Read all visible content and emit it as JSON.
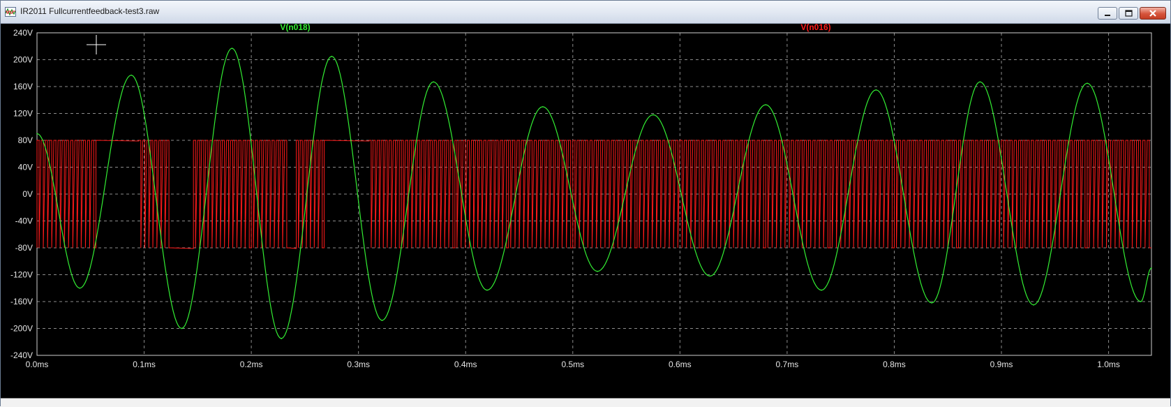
{
  "window": {
    "title": "IR2011 Fullcurrentfeedback-test3.raw",
    "app_icon": "waveform-icon",
    "controls": [
      "minimize-icon",
      "maximize-icon",
      "close-icon"
    ]
  },
  "colors": {
    "background": "#000000",
    "grid": "#8c8c8c",
    "axis_text": "#e6e6e6",
    "series_green": "#33ee33",
    "series_red": "#ff1a1a"
  },
  "chart_data": {
    "type": "line",
    "title": "",
    "xlabel": "",
    "ylabel": "",
    "xlim": [
      0,
      1.04
    ],
    "ylim": [
      -240,
      240
    ],
    "grid": true,
    "x_ticks": [
      0,
      0.1,
      0.2,
      0.3,
      0.4,
      0.5,
      0.6,
      0.7,
      0.8,
      0.9,
      1.0
    ],
    "x_tick_labels": [
      "0.0ms",
      "0.1ms",
      "0.2ms",
      "0.3ms",
      "0.4ms",
      "0.5ms",
      "0.6ms",
      "0.7ms",
      "0.8ms",
      "0.9ms",
      "1.0ms"
    ],
    "y_ticks": [
      240,
      200,
      160,
      120,
      80,
      40,
      0,
      -40,
      -80,
      -120,
      -160,
      -200,
      -240
    ],
    "y_tick_labels": [
      "240V",
      "200V",
      "160V",
      "120V",
      "80V",
      "40V",
      "0V",
      "-40V",
      "-80V",
      "-120V",
      "-160V",
      "-200V",
      "-240V"
    ],
    "series": [
      {
        "name": "V(n018)",
        "color": "#33ee33",
        "kind": "sine",
        "x": [
          0.0,
          0.04,
          0.088,
          0.135,
          0.182,
          0.228,
          0.275,
          0.322,
          0.37,
          0.42,
          0.472,
          0.523,
          0.575,
          0.628,
          0.68,
          0.732,
          0.783,
          0.835,
          0.88,
          0.93,
          0.98,
          1.03,
          1.04
        ],
        "y": [
          90,
          -140,
          177,
          -200,
          217,
          -215,
          205,
          -188,
          167,
          -143,
          130,
          -115,
          118,
          -122,
          133,
          -143,
          155,
          -162,
          167,
          -165,
          165,
          -160,
          -110
        ]
      },
      {
        "name": "V(n016)",
        "color": "#ff1a1a",
        "kind": "pwm",
        "high": 80,
        "low": -80,
        "segments": [
          {
            "x0": 0.0,
            "x1": 0.055,
            "state": "switching"
          },
          {
            "x0": 0.055,
            "x1": 0.095,
            "state": "high"
          },
          {
            "x0": 0.095,
            "x1": 0.125,
            "state": "switching"
          },
          {
            "x0": 0.125,
            "x1": 0.146,
            "state": "low"
          },
          {
            "x0": 0.146,
            "x1": 0.2,
            "state": "switching"
          },
          {
            "x0": 0.2,
            "x1": 0.235,
            "state": "switching"
          },
          {
            "x0": 0.235,
            "x1": 0.242,
            "state": "low"
          },
          {
            "x0": 0.242,
            "x1": 0.268,
            "state": "switching"
          },
          {
            "x0": 0.268,
            "x1": 0.31,
            "state": "high"
          },
          {
            "x0": 0.31,
            "x1": 0.34,
            "state": "switching"
          },
          {
            "x0": 0.34,
            "x1": 0.39,
            "state": "switching"
          },
          {
            "x0": 0.39,
            "x1": 0.44,
            "state": "switching"
          },
          {
            "x0": 0.44,
            "x1": 0.5,
            "state": "switching"
          },
          {
            "x0": 0.5,
            "x1": 0.56,
            "state": "switching"
          },
          {
            "x0": 0.56,
            "x1": 0.62,
            "state": "switching"
          },
          {
            "x0": 0.62,
            "x1": 0.68,
            "state": "switching"
          },
          {
            "x0": 0.68,
            "x1": 0.74,
            "state": "switching"
          },
          {
            "x0": 0.74,
            "x1": 0.8,
            "state": "switching"
          },
          {
            "x0": 0.8,
            "x1": 0.86,
            "state": "switching"
          },
          {
            "x0": 0.86,
            "x1": 0.92,
            "state": "switching"
          },
          {
            "x0": 0.92,
            "x1": 0.98,
            "state": "switching"
          },
          {
            "x0": 0.98,
            "x1": 1.04,
            "state": "switching"
          }
        ]
      }
    ],
    "legend": {
      "placement": "top"
    }
  },
  "cursor": {
    "icon": "crosshair-cursor-icon"
  }
}
